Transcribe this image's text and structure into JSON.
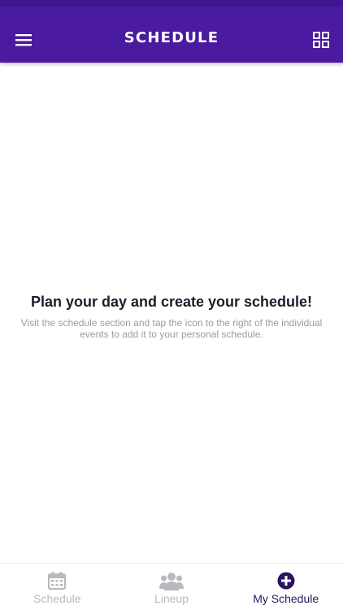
{
  "header": {
    "title": "SCHEDULE",
    "menu_icon": "hamburger-menu-icon",
    "grid_icon": "grid-view-icon",
    "background": "#4a1aa0"
  },
  "empty_state": {
    "heading": "Plan your day and create your schedule!",
    "body": "Visit the schedule section and tap the icon to the right of the individual events to add it to your personal schedule."
  },
  "bottom_nav": {
    "items": [
      {
        "label": "Schedule",
        "icon": "calendar-icon",
        "active": false
      },
      {
        "label": "Lineup",
        "icon": "group-icon",
        "active": false
      },
      {
        "label": "My Schedule",
        "icon": "plus-circle-icon",
        "active": true
      }
    ],
    "active_color": "#2b1463",
    "inactive_color": "#b9b9bd"
  }
}
